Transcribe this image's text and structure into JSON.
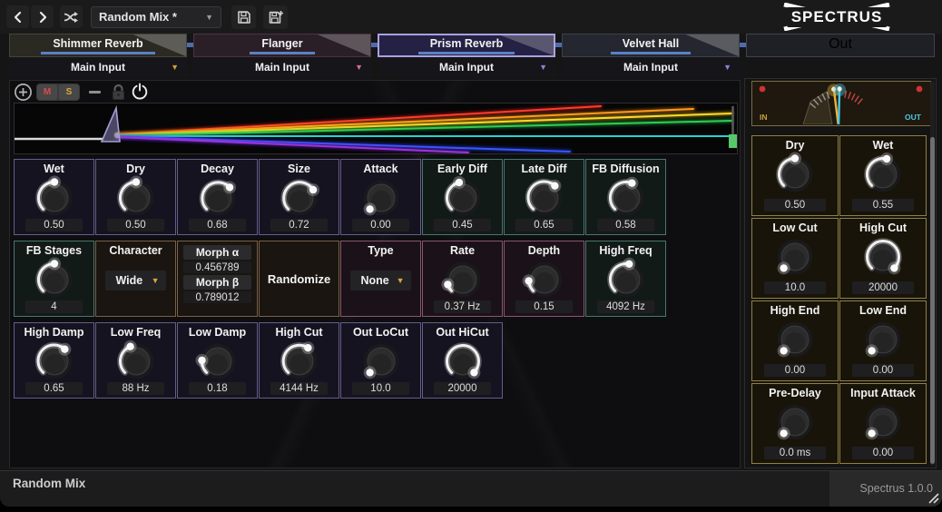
{
  "toolbar": {
    "preset_value": "Random Mix *",
    "logo": "SPECTRUS"
  },
  "tabs": [
    {
      "label": "Shimmer Reverb",
      "input_label": "Main Input",
      "caret_color": "#c9a23b",
      "bg": "#2a2922",
      "border": "#45453c",
      "selected": false
    },
    {
      "label": "Flanger",
      "input_label": "Main Input",
      "caret_color": "#d56f8d",
      "bg": "#2b1f27",
      "border": "#4a3340",
      "selected": false
    },
    {
      "label": "Prism Reverb",
      "input_label": "Main Input",
      "caret_color": "#8f82d8",
      "bg": "#252145",
      "border": "#a9a1de",
      "selected": true
    },
    {
      "label": "Velvet Hall",
      "input_label": "Main Input",
      "caret_color": "#8f82d8",
      "bg": "#24272f",
      "border": "#3c4049",
      "selected": false
    }
  ],
  "out_tab": {
    "label": "Out"
  },
  "mini_toolbar": {
    "mute_label": "M",
    "solo_label": "S"
  },
  "grid_rows": [
    [
      {
        "type": "knob",
        "label": "Wet",
        "value": "0.50",
        "norm": 0.5,
        "group": "purple"
      },
      {
        "type": "knob",
        "label": "Dry",
        "value": "0.50",
        "norm": 0.5,
        "group": "purple"
      },
      {
        "type": "knob",
        "label": "Decay",
        "value": "0.68",
        "norm": 0.68,
        "group": "purple"
      },
      {
        "type": "knob",
        "label": "Size",
        "value": "0.72",
        "norm": 0.72,
        "group": "purple"
      },
      {
        "type": "knob",
        "label": "Attack",
        "value": "0.00",
        "norm": 0.0,
        "group": "purple"
      },
      {
        "type": "knob",
        "label": "Early Diff",
        "value": "0.45",
        "norm": 0.45,
        "group": "teal"
      },
      {
        "type": "knob",
        "label": "Late Diff",
        "value": "0.65",
        "norm": 0.65,
        "group": "teal"
      },
      {
        "type": "knob",
        "label": "FB Diffusion",
        "value": "0.58",
        "norm": 0.58,
        "group": "teal"
      }
    ],
    [
      {
        "type": "knob",
        "label": "FB Stages",
        "value": "4",
        "norm": 0.5,
        "group": "teal"
      },
      {
        "type": "dropdown",
        "label": "Character",
        "value": "Wide",
        "group": "tan"
      },
      {
        "type": "morph",
        "group": "tan",
        "items": [
          {
            "label": "Morph α",
            "value": "0.456789"
          },
          {
            "label": "Morph β",
            "value": "0.789012"
          }
        ]
      },
      {
        "type": "button",
        "label": "Randomize",
        "group": "tan"
      },
      {
        "type": "dropdown",
        "label": "Type",
        "value": "None",
        "group": "pink"
      },
      {
        "type": "knob",
        "label": "Rate",
        "value": "0.37 Hz",
        "norm": 0.1,
        "group": "pink"
      },
      {
        "type": "knob",
        "label": "Depth",
        "value": "0.15",
        "norm": 0.15,
        "group": "pink"
      },
      {
        "type": "knob",
        "label": "High Freq",
        "value": "4092 Hz",
        "norm": 0.54,
        "group": "teal"
      }
    ],
    [
      {
        "type": "knob",
        "label": "High Damp",
        "value": "0.65",
        "norm": 0.65,
        "group": "purple"
      },
      {
        "type": "knob",
        "label": "Low Freq",
        "value": "88 Hz",
        "norm": 0.42,
        "group": "purple"
      },
      {
        "type": "knob",
        "label": "Low Damp",
        "value": "0.18",
        "norm": 0.18,
        "group": "purple"
      },
      {
        "type": "knob",
        "label": "High Cut",
        "value": "4144 Hz",
        "norm": 0.62,
        "group": "purple"
      },
      {
        "type": "knob",
        "label": "Out LoCut",
        "value": "10.0",
        "norm": 0.0,
        "group": "purple"
      },
      {
        "type": "knob",
        "label": "Out HiCut",
        "value": "20000",
        "norm": 1.0,
        "group": "purple"
      }
    ]
  ],
  "right_panel": {
    "meter": {
      "in_label": "IN",
      "out_label": "OUT"
    },
    "cells": [
      {
        "label": "Dry",
        "value": "0.50",
        "norm": 0.5
      },
      {
        "label": "Wet",
        "value": "0.55",
        "norm": 0.55
      },
      {
        "label": "Low Cut",
        "value": "10.0",
        "norm": 0.0
      },
      {
        "label": "High Cut",
        "value": "20000",
        "norm": 1.0
      },
      {
        "label": "High End",
        "value": "0.00",
        "norm": 0.0
      },
      {
        "label": "Low End",
        "value": "0.00",
        "norm": 0.0
      },
      {
        "label": "Pre-Delay",
        "value": "0.0 ms",
        "norm": 0.0
      },
      {
        "label": "Input Attack",
        "value": "0.00",
        "norm": 0.0
      }
    ]
  },
  "status_bar": {
    "preset_name": "Random Mix",
    "version": "Spectrus 1.0.0"
  },
  "colors": {
    "tab_underline": "#5b80c4",
    "connector_blue": "#4f6cab",
    "mute_red": "#e04848",
    "solo_yellow": "#e0a838",
    "meter_in_gold": "#c9a23b",
    "meter_out_cyan": "#4ec9e0",
    "group_purple": "#665c8c",
    "group_teal": "#47776e",
    "group_tan": "#7a6144",
    "group_pink": "#8a5572",
    "group_gold": "#93803f"
  }
}
